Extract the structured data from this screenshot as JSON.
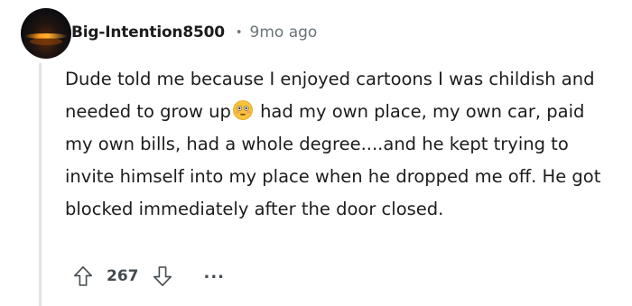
{
  "comment": {
    "username": "Big-Intention8500",
    "separator": "•",
    "time_ago": "9mo ago",
    "text_part1": "Dude told me because I enjoyed cartoons I was childish and needed to grow up",
    "emoji": "flushed-face-emoji",
    "text_part2": " had my own place, my own car, paid my own bills, had a whole degree....and he kept trying to invite himself into my place when he dropped me off. He got blocked immediately after the door closed.",
    "score": "267",
    "more_label": "..."
  },
  "colors": {
    "text": "#1c1c1c",
    "meta": "#6a7378",
    "thread_line": "#dde3e7",
    "icon": "#444b50"
  }
}
